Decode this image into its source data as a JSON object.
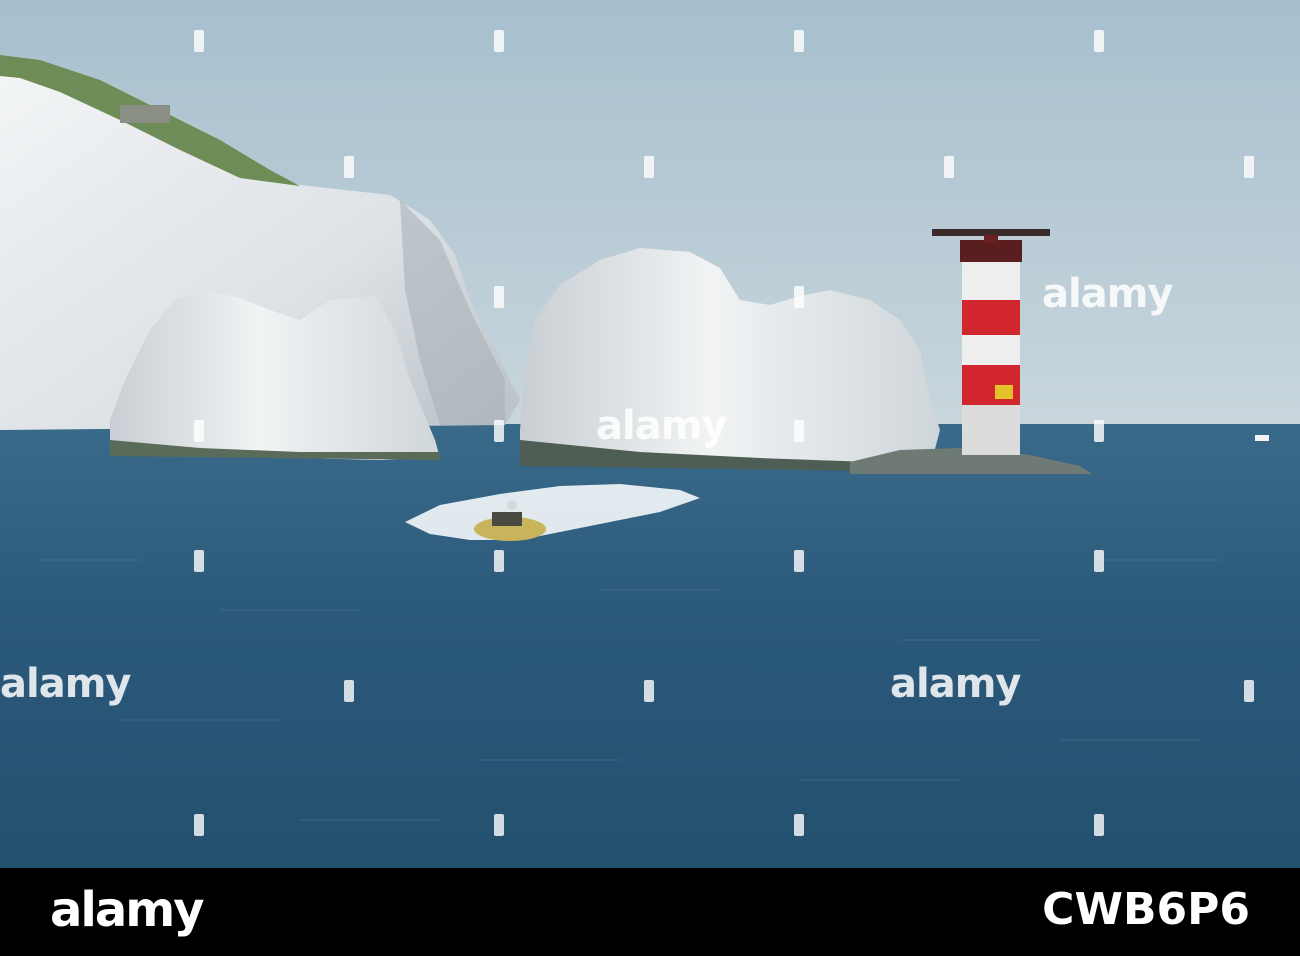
{
  "image": {
    "subject": "seascape",
    "colors": {
      "sky": "#a9c1cf",
      "sea": "#2d5d7e",
      "chalk": "#e8ecef",
      "grass": "#6e8c55",
      "lighthouse_red": "#d1262d",
      "lighthouse_white": "#eeeeee",
      "wake": "#ffffff"
    }
  },
  "watermark": {
    "text": "alamy"
  },
  "footer": {
    "brand": "alamy",
    "image_code": "CWB6P6"
  }
}
